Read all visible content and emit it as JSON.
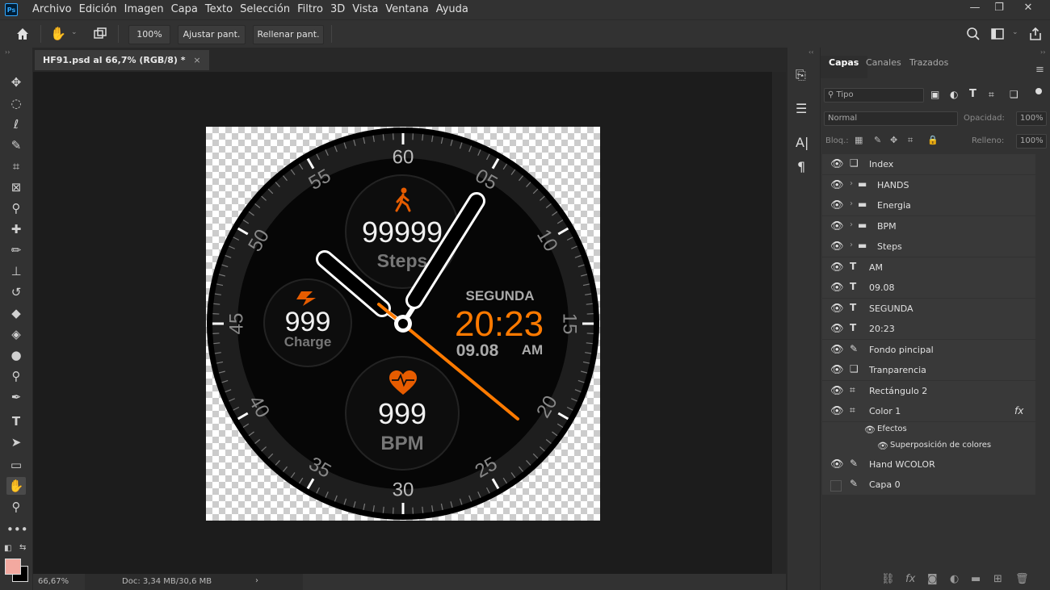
{
  "app": {
    "logo": "Ps"
  },
  "menu": [
    "Archivo",
    "Edición",
    "Imagen",
    "Capa",
    "Texto",
    "Selección",
    "Filtro",
    "3D",
    "Vista",
    "Ventana",
    "Ayuda"
  ],
  "options": {
    "zoom": "100%",
    "fit_screen": "Ajustar pant.",
    "fill_screen": "Rellenar pant."
  },
  "document": {
    "tab_title": "HF91.psd al 66,7% (RGB/8) *",
    "close": "×"
  },
  "status": {
    "zoom": "66,67%",
    "doc": "Doc: 3,34 MB/30,6 MB",
    "arrow": "›"
  },
  "watch": {
    "minute_labels": [
      "60",
      "05",
      "10",
      "15",
      "20",
      "25",
      "30",
      "35",
      "40",
      "45",
      "50",
      "55"
    ],
    "steps_value": "99999",
    "steps_label": "Steps",
    "charge_value": "999",
    "charge_label": "Charge",
    "bpm_value": "999",
    "bpm_label": "BPM",
    "day": "SEGUNDA",
    "time": "20:23",
    "date": "09.08",
    "ampm": "AM",
    "accent": "#ff7a00"
  },
  "panel": {
    "tabs": [
      "Capas",
      "Canales",
      "Trazados"
    ],
    "filter": "Tipo",
    "blend_mode": "Normal",
    "opacity_label": "Opacidad:",
    "opacity": "100%",
    "lock_label": "Bloq.:",
    "fill_label": "Relleno:",
    "fill": "100%",
    "layers": [
      {
        "name": "Index",
        "icon": "smart",
        "visible": true
      },
      {
        "name": "HANDS",
        "icon": "folder",
        "visible": true
      },
      {
        "name": "Energia",
        "icon": "folder",
        "visible": true
      },
      {
        "name": "BPM",
        "icon": "folder",
        "visible": true
      },
      {
        "name": "Steps",
        "icon": "folder",
        "visible": true
      },
      {
        "name": "AM",
        "icon": "text",
        "visible": true
      },
      {
        "name": "09.08",
        "icon": "text",
        "visible": true
      },
      {
        "name": "SEGUNDA",
        "icon": "text",
        "visible": true
      },
      {
        "name": "20:23",
        "icon": "text",
        "visible": true
      },
      {
        "name": "Fondo pincipal",
        "icon": "brush",
        "visible": true
      },
      {
        "name": "Tranparencia",
        "icon": "smart",
        "visible": true
      },
      {
        "name": "Rectángulo 2",
        "icon": "shape",
        "visible": true
      },
      {
        "name": "Color 1",
        "icon": "shape",
        "visible": true,
        "fx": "fx"
      }
    ],
    "effects_label": "Efectos",
    "effect_item": "Superposición de colores",
    "layers_after": [
      {
        "name": "Hand WCOLOR",
        "icon": "brush",
        "visible": true
      },
      {
        "name": "Capa 0",
        "icon": "brush",
        "visible": false
      }
    ]
  }
}
